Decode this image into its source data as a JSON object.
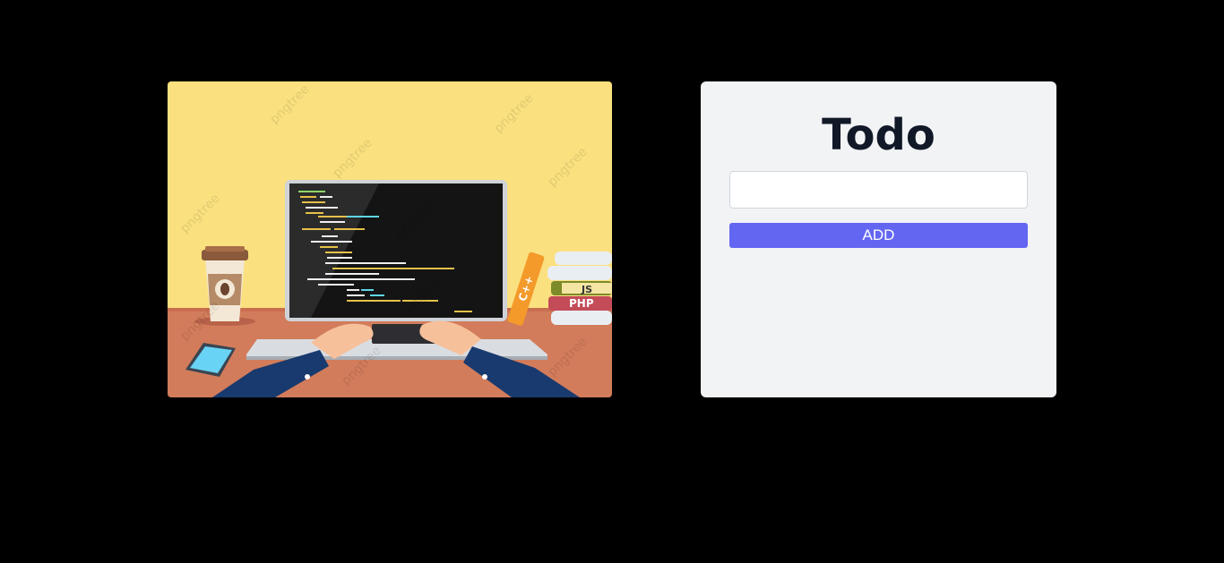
{
  "todo": {
    "title": "Todo",
    "input_value": "",
    "input_placeholder": "",
    "add_label": "ADD"
  },
  "illustration": {
    "book_labels": [
      "C++",
      "JS",
      "PHP"
    ],
    "watermark": "pngtree",
    "colors": {
      "wall": "#fbe07f",
      "desk": "#d27c5b",
      "accent": "#6366f1",
      "card": "#f2f3f5"
    }
  }
}
